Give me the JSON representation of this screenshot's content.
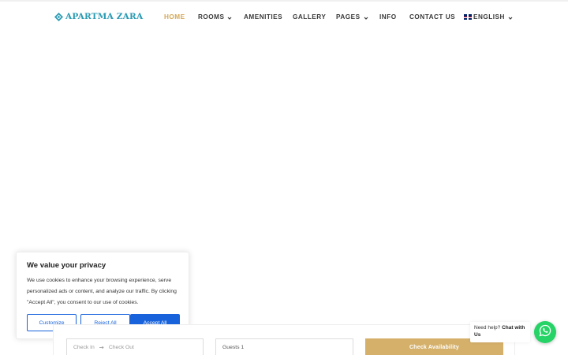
{
  "brand": {
    "name": "APARTMA ZARA",
    "color": "#2b9bb3"
  },
  "nav": {
    "items": [
      {
        "label": "HOME",
        "active": true,
        "dropdown": false
      },
      {
        "label": "ROOMS",
        "active": false,
        "dropdown": true
      },
      {
        "label": "AMENITIES",
        "active": false,
        "dropdown": false
      },
      {
        "label": "GALLERY",
        "active": false,
        "dropdown": false
      },
      {
        "label": "PAGES",
        "active": false,
        "dropdown": true
      },
      {
        "label": "INFO",
        "active": false,
        "dropdown": false
      },
      {
        "label": "CONTACT US",
        "active": false,
        "dropdown": false
      }
    ],
    "language": {
      "label": "ENGLISH",
      "icon": "uk-flag-icon"
    },
    "active_color": "#d4a857"
  },
  "cookie": {
    "title": "We value your privacy",
    "text": "We use cookies to enhance your browsing experience, serve personalized ads or content, and analyze our traffic. By clicking \"Accept All\", you consent to our use of cookies.",
    "customize": "Customize",
    "reject": "Reject All",
    "accept": "Accept All",
    "accent": "#1863dc"
  },
  "booking": {
    "check_in": "Check In",
    "check_out": "Check Out",
    "guests": "Guests 1",
    "submit": "Check Availability",
    "submit_color": "#d4b06a"
  },
  "help": {
    "prefix": "Need help?",
    "cta": "Chat with Us",
    "icon": "whatsapp-icon"
  }
}
